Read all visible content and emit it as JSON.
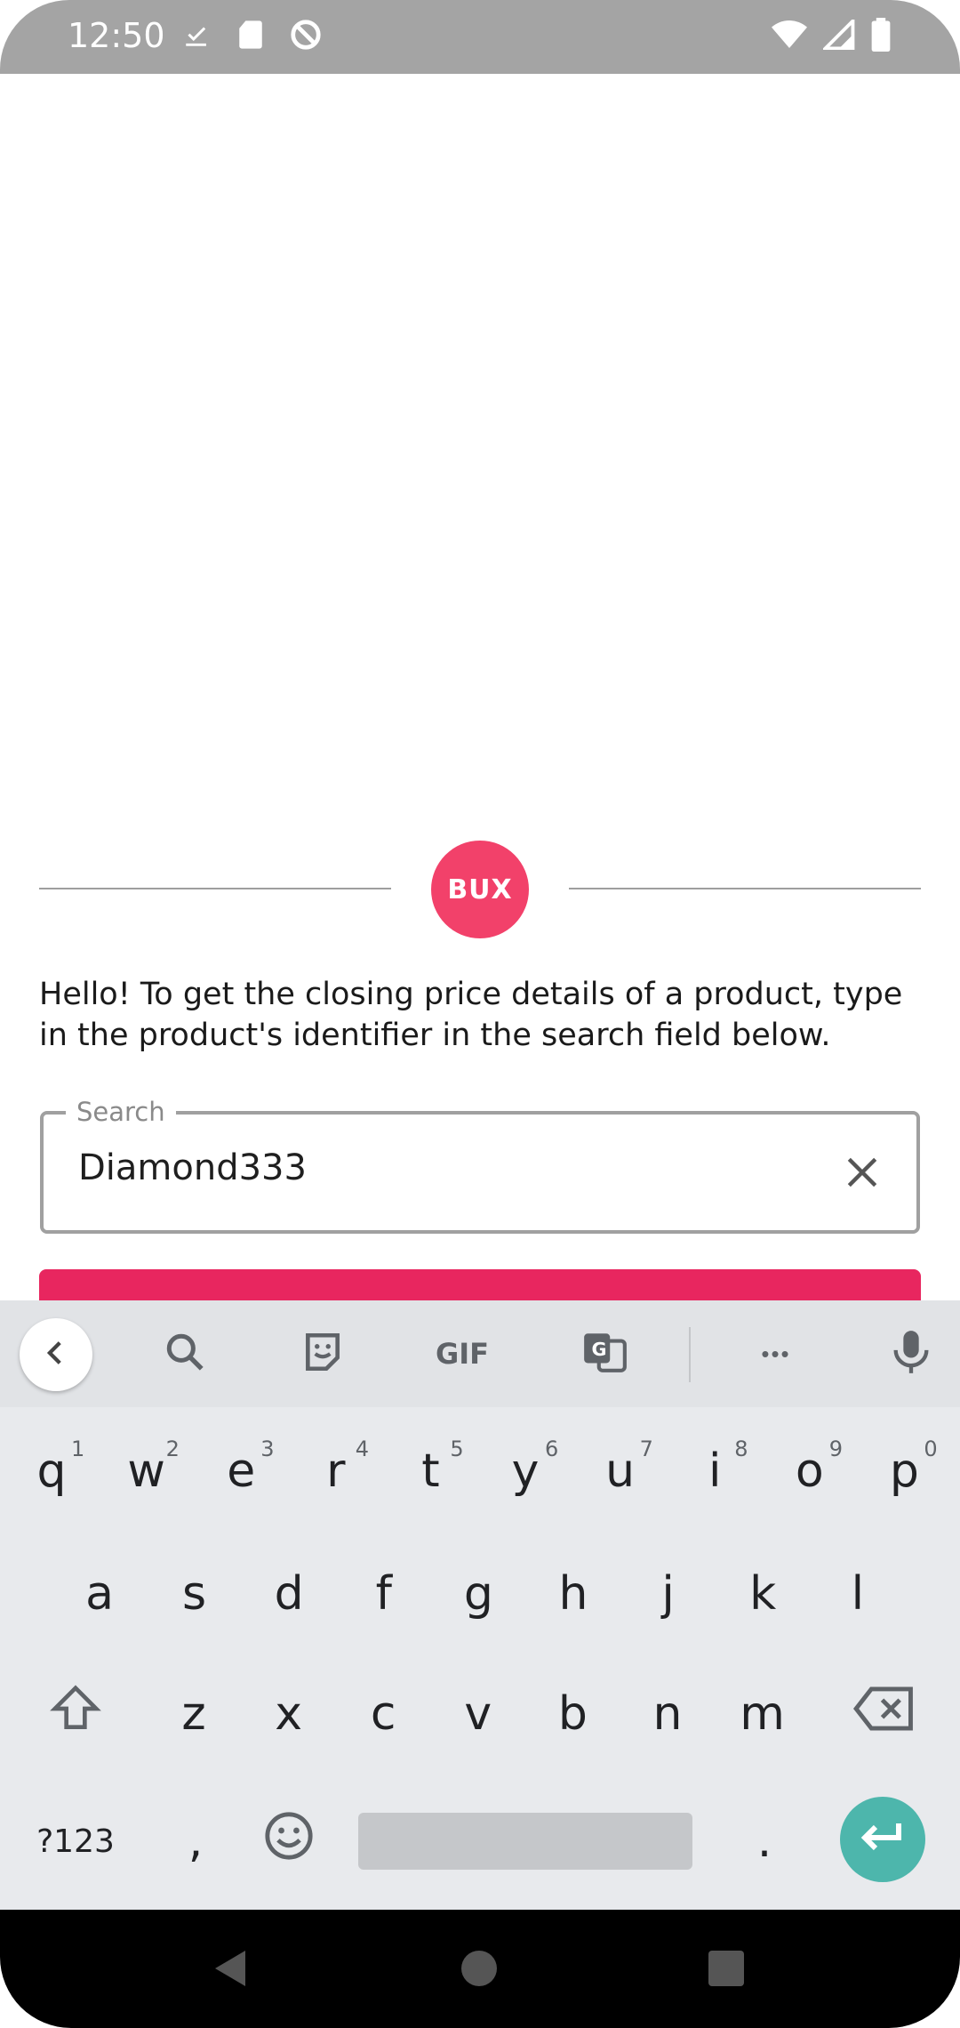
{
  "status_bar": {
    "time": "12:50",
    "left_icons": [
      "checkbox-icon",
      "sd-card-icon",
      "blocked-sync-icon"
    ],
    "right_icons": [
      "wifi-icon",
      "signal-icon",
      "battery-icon"
    ]
  },
  "logo": {
    "text": "BUX",
    "color": "#f2416a"
  },
  "intro": {
    "text": "Hello! To get the closing price details of a product, type in the product's identifier in the search field below."
  },
  "search": {
    "label": "Search",
    "value": "Diamond333"
  },
  "colors": {
    "accent": "#e8265f",
    "enter_key": "#4db6ac"
  },
  "keyboard": {
    "toolbar": [
      "back-icon",
      "search-icon",
      "sticker-icon",
      "gif-icon",
      "translate-icon",
      "more-icon",
      "mic-icon"
    ],
    "gif_label": "GIF",
    "more_label": "•••",
    "row1": [
      {
        "k": "q",
        "h": "1"
      },
      {
        "k": "w",
        "h": "2"
      },
      {
        "k": "e",
        "h": "3"
      },
      {
        "k": "r",
        "h": "4"
      },
      {
        "k": "t",
        "h": "5"
      },
      {
        "k": "y",
        "h": "6"
      },
      {
        "k": "u",
        "h": "7"
      },
      {
        "k": "i",
        "h": "8"
      },
      {
        "k": "o",
        "h": "9"
      },
      {
        "k": "p",
        "h": "0"
      }
    ],
    "row2": [
      "a",
      "s",
      "d",
      "f",
      "g",
      "h",
      "j",
      "k",
      "l"
    ],
    "row3": [
      "z",
      "x",
      "c",
      "v",
      "b",
      "n",
      "m"
    ],
    "symbols_label": "?123",
    "comma": ",",
    "period": "."
  }
}
